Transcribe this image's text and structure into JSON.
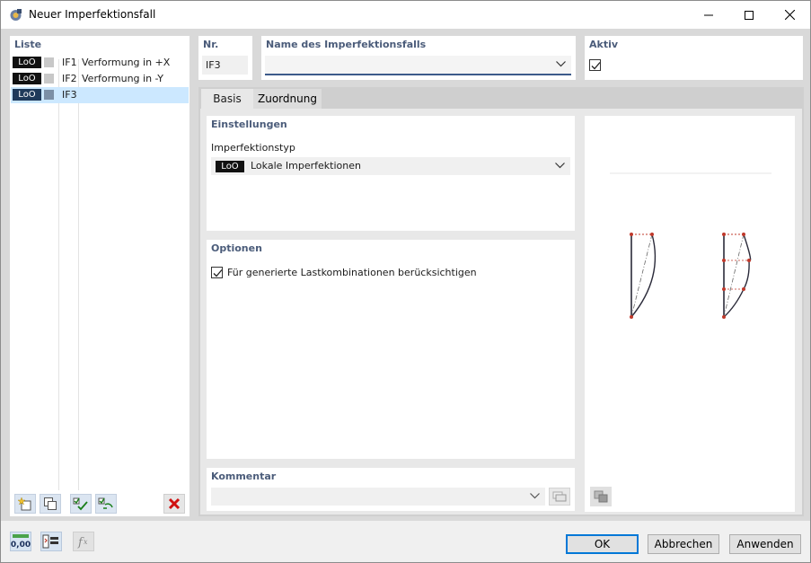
{
  "window": {
    "title": "Neuer Imperfektionsfall"
  },
  "list": {
    "header": "Liste",
    "items": [
      {
        "badge": "LoO",
        "id": "IF1",
        "name": "Verformung in +X"
      },
      {
        "badge": "LoO",
        "id": "IF2",
        "name": "Verformung in -Y"
      },
      {
        "badge": "LoO",
        "id": "IF3",
        "name": ""
      }
    ],
    "selected_index": 2
  },
  "fields": {
    "nr_label": "Nr.",
    "nr_value": "IF3",
    "name_label": "Name des Imperfektionsfalls",
    "name_value": "",
    "aktiv_label": "Aktiv",
    "aktiv_checked": true
  },
  "tabs": [
    {
      "label": "Basis",
      "active": true
    },
    {
      "label": "Zuordnung",
      "active": false
    }
  ],
  "einstellungen": {
    "header": "Einstellungen",
    "type_label": "Imperfektionstyp",
    "type_badge": "LoO",
    "type_value": "Lokale Imperfektionen"
  },
  "optionen": {
    "header": "Optionen",
    "checkbox_label": "Für generierte Lastkombinationen berücksichtigen",
    "checked": true
  },
  "kommentar": {
    "header": "Kommentar",
    "value": ""
  },
  "bottom": {
    "ok_label": "OK",
    "cancel_label": "Abbrechen",
    "apply_label": "Anwenden",
    "units_icon_text": "0,00"
  },
  "colors": {
    "accent": "#0078d7",
    "section_label": "#4b5c7a",
    "selected_row": "#cce8ff",
    "point_red": "#c0392b"
  }
}
